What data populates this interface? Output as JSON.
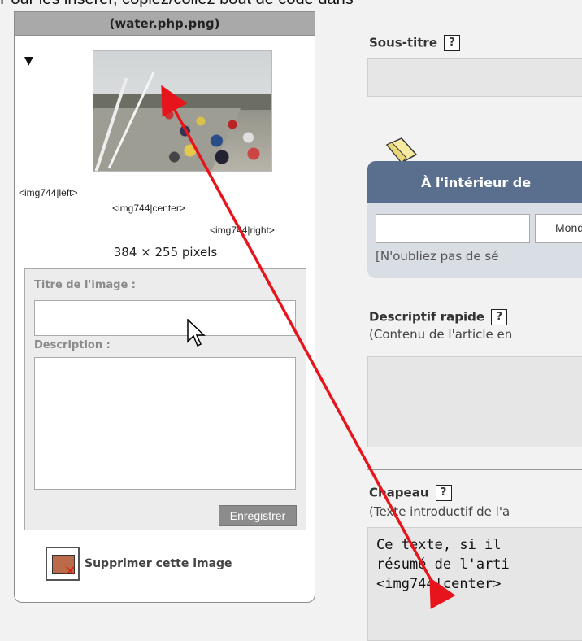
{
  "top_banner": "Pour les insérer, copiez/collez  bout de code dans",
  "left_panel": {
    "header_ghost": "Sous-titre",
    "header_title": "(water.php.png)",
    "collapse_glyph": "▼",
    "tag_left": "<img744|left>",
    "tag_center": "<img744|center>",
    "tag_right": "<img744|right>",
    "dimensions": "384 × 255 pixels",
    "title_label": "Titre de l'image :",
    "title_value": "",
    "description_label": "Description :",
    "description_value": "",
    "save_label": "Enregistrer",
    "delete_label": "Supprimer cette image"
  },
  "right_panel": {
    "subtitle_label": "Sous-titre",
    "help_glyph": "?",
    "interior_title": "À l'intérieur de",
    "interior_select_value": "Mond",
    "interior_note": "[N'oubliez pas de sé",
    "quick_desc_label": "Descriptif rapide",
    "quick_desc_hint": "(Contenu de l'article en",
    "chapeau_label": "Chapeau",
    "chapeau_hint": "(Texte introductif de l'a",
    "chapeau_line1": "Ce texte, si il",
    "chapeau_line2": "résumé de l'arti",
    "chapeau_line3": "<img744|center>"
  },
  "colors": {
    "arrow": "#e8141b",
    "header_gray": "#a9a9a9",
    "interior_blue": "#5a6f8e"
  }
}
